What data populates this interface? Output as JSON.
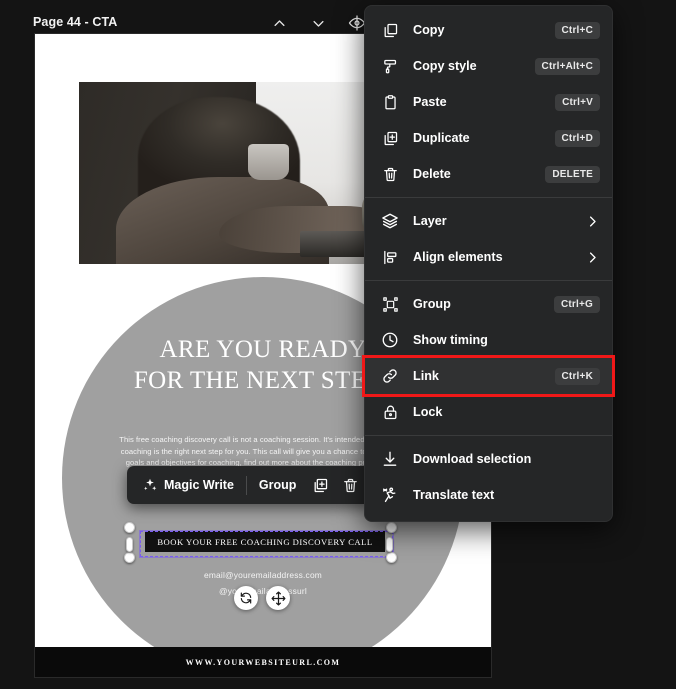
{
  "header": {
    "page_title": "Page 44 - CTA",
    "icons": [
      {
        "name": "chevron-up-icon",
        "label": "Previous page"
      },
      {
        "name": "chevron-down-icon",
        "label": "Next page"
      },
      {
        "name": "eye-off-icon",
        "label": "Hide page"
      }
    ]
  },
  "slide": {
    "heading_line1": "ARE YOU READY",
    "heading_line2": "FOR THE NEXT STEP?",
    "body": "This free coaching discovery call is not a coaching session. It's intended to find out if coaching is the right next step for you. This call will give you a chance to share your goals and objectives for coaching, find out more about the coaching process and whether I'm the right coach for you.",
    "cta_button": "BOOK YOUR FREE COACHING DISCOVERY CALL",
    "email": "email@youremailaddress.com",
    "social": "@youremailaddressurl",
    "footer": "WWW.YOURWEBSITEURL.COM"
  },
  "float_toolbar": {
    "magic_write": "Magic Write",
    "group": "Group",
    "duplicate_icon": "duplicate-icon",
    "delete_icon": "trash-icon"
  },
  "context_menu": {
    "groups": [
      {
        "items": [
          {
            "id": "copy",
            "icon": "copy-icon",
            "label": "Copy",
            "shortcut": "Ctrl+C",
            "submenu": false,
            "highlighted": false
          },
          {
            "id": "copy-style",
            "icon": "paint-roller-icon",
            "label": "Copy style",
            "shortcut": "Ctrl+Alt+C",
            "submenu": false,
            "highlighted": false
          },
          {
            "id": "paste",
            "icon": "clipboard-icon",
            "label": "Paste",
            "shortcut": "Ctrl+V",
            "submenu": false,
            "highlighted": false
          },
          {
            "id": "duplicate",
            "icon": "duplicate-icon",
            "label": "Duplicate",
            "shortcut": "Ctrl+D",
            "submenu": false,
            "highlighted": false
          },
          {
            "id": "delete",
            "icon": "trash-icon",
            "label": "Delete",
            "shortcut": "DELETE",
            "submenu": false,
            "highlighted": false
          }
        ]
      },
      {
        "items": [
          {
            "id": "layer",
            "icon": "layers-icon",
            "label": "Layer",
            "shortcut": "",
            "submenu": true,
            "highlighted": false
          },
          {
            "id": "align-elements",
            "icon": "align-icon",
            "label": "Align elements",
            "shortcut": "",
            "submenu": true,
            "highlighted": false
          }
        ]
      },
      {
        "items": [
          {
            "id": "group",
            "icon": "group-icon",
            "label": "Group",
            "shortcut": "Ctrl+G",
            "submenu": false,
            "highlighted": false
          },
          {
            "id": "show-timing",
            "icon": "clock-icon",
            "label": "Show timing",
            "shortcut": "",
            "submenu": false,
            "highlighted": false
          },
          {
            "id": "link",
            "icon": "link-icon",
            "label": "Link",
            "shortcut": "Ctrl+K",
            "submenu": false,
            "highlighted": true
          },
          {
            "id": "lock",
            "icon": "lock-icon",
            "label": "Lock",
            "shortcut": "",
            "submenu": false,
            "highlighted": false
          }
        ]
      },
      {
        "items": [
          {
            "id": "download-selection",
            "icon": "download-icon",
            "label": "Download selection",
            "shortcut": "",
            "submenu": false,
            "highlighted": false
          },
          {
            "id": "translate-text",
            "icon": "translate-icon",
            "label": "Translate text",
            "shortcut": "",
            "submenu": false,
            "highlighted": false
          }
        ]
      }
    ]
  },
  "selection": {
    "rotate_icon": "rotate-icon",
    "move_icon": "move-icon"
  },
  "colors": {
    "menu_bg": "#252627",
    "highlight_red": "#f01818",
    "selection_purple": "#7a5cf0",
    "circle_gray": "#a0a0a0",
    "shortcut_badge": "#3c3d3e"
  }
}
